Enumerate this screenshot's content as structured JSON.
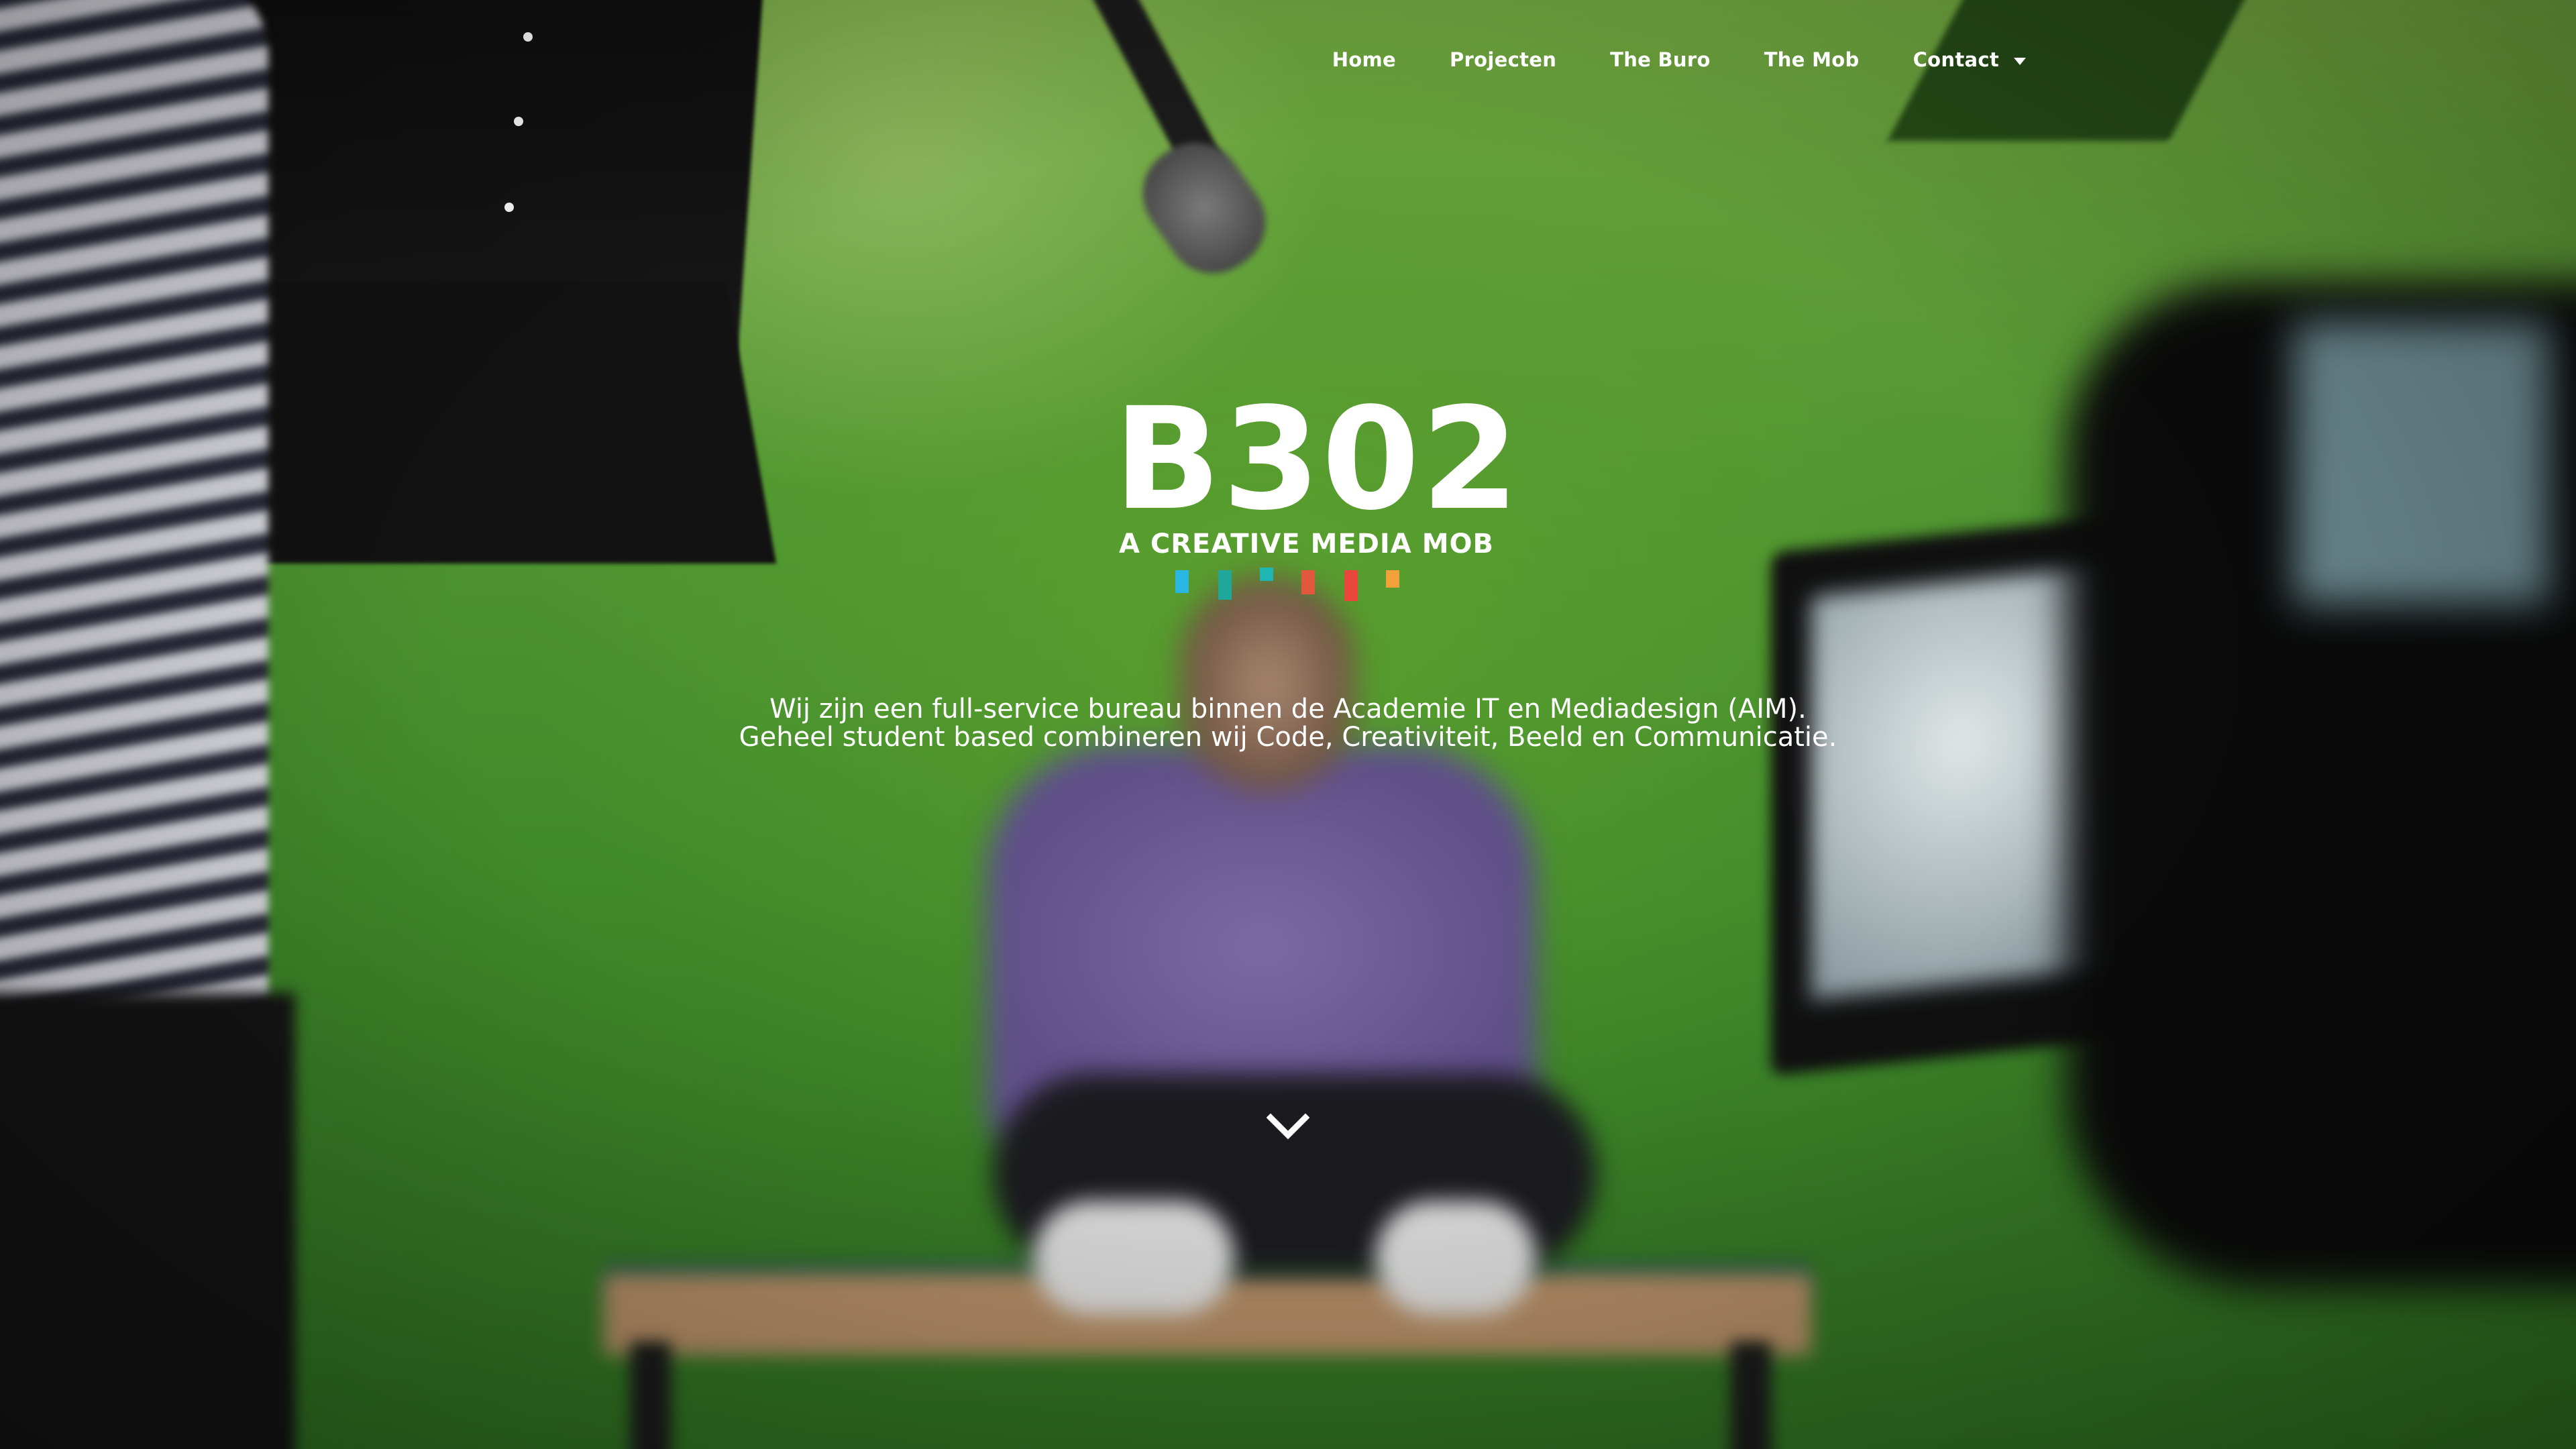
{
  "nav": {
    "items": [
      {
        "label": "Home"
      },
      {
        "label": "Projecten"
      },
      {
        "label": "The Buro"
      },
      {
        "label": "The Mob"
      },
      {
        "label": "Contact",
        "has_dropdown": true
      }
    ]
  },
  "logo": {
    "title": "B302",
    "subtitle": "A CREATIVE MEDIA MOB",
    "bar_colors": [
      "#29b6e0",
      "#1fa89a",
      "#1fb5b0",
      "#e2583e",
      "#e8473a",
      "#f2a13a"
    ]
  },
  "hero": {
    "line1": "Wij zijn een full-service bureau binnen de Academie IT en Mediadesign (AIM).",
    "line2": "Geheel student based combineren wij Code, Creativiteit, Beeld en Communicatie."
  },
  "icons": {
    "scroll_down": "chevron-down-icon",
    "dropdown": "caret-down-icon"
  }
}
